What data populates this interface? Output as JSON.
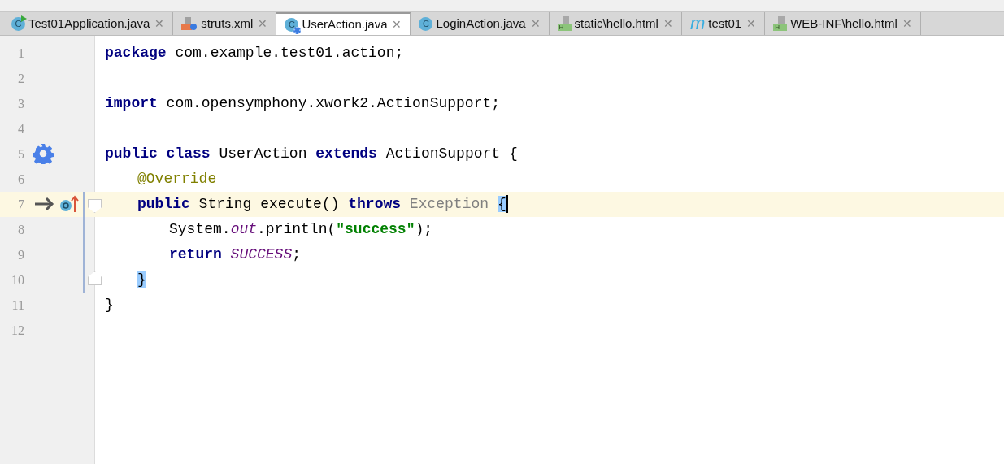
{
  "tabs": [
    {
      "label": "Test01Application.java",
      "selected": false,
      "kind": "spring_class",
      "glyph": "C",
      "close": "✕"
    },
    {
      "label": "struts.xml",
      "selected": false,
      "kind": "xml",
      "close": "✕"
    },
    {
      "label": "UserAction.java",
      "selected": true,
      "kind": "class_gear",
      "glyph": "C",
      "close": "✕"
    },
    {
      "label": "LoginAction.java",
      "selected": false,
      "kind": "class",
      "glyph": "C",
      "close": "✕"
    },
    {
      "label": "static\\hello.html",
      "selected": false,
      "kind": "html",
      "glyph": "H",
      "close": "✕"
    },
    {
      "label": "test01",
      "selected": false,
      "kind": "maven",
      "glyph": "m",
      "close": "✕"
    },
    {
      "label": "WEB-INF\\hello.html",
      "selected": false,
      "kind": "html",
      "glyph": "H",
      "close": "✕"
    }
  ],
  "editor": {
    "lines": [
      {
        "number": "1",
        "tokens": [
          {
            "t": "package",
            "kind": "keyword"
          },
          {
            "t": " com.example.test01.action;",
            "kind": "plain"
          }
        ]
      },
      {
        "number": "2"
      },
      {
        "number": "3",
        "tokens": [
          {
            "t": "import",
            "kind": "keyword"
          },
          {
            "t": " com.opensymphony.xwork2.ActionSupport;",
            "kind": "plain"
          }
        ]
      },
      {
        "number": "4"
      },
      {
        "number": "5",
        "kind": "class_declaration",
        "tokens": [
          {
            "t": "public class",
            "kind": "keyword"
          },
          {
            "t": " UserAction ",
            "kind": "plain"
          },
          {
            "t": "extends",
            "kind": "keyword"
          },
          {
            "t": " ActionSupport {",
            "kind": "plain"
          }
        ],
        "children": [
          {
            "number": "6",
            "tokens": [
              {
                "t": "@Override",
                "kind": "annotation"
              }
            ]
          },
          {
            "number": "7",
            "kind": "overriding_method",
            "current": true,
            "fold_start": true,
            "caret": true,
            "tokens": [
              {
                "t": "public",
                "kind": "keyword"
              },
              {
                "t": " String execute() ",
                "kind": "plain"
              },
              {
                "t": "throws",
                "kind": "keyword"
              },
              {
                "t": " Exception ",
                "kind": "muted"
              },
              {
                "t": "{",
                "kind": "brace_match"
              }
            ],
            "children": [
              {
                "number": "8",
                "tokens": [
                  {
                    "t": "System.",
                    "kind": "plain"
                  },
                  {
                    "t": "out",
                    "kind": "static"
                  },
                  {
                    "t": ".println(",
                    "kind": "plain"
                  },
                  {
                    "t": "\"success\"",
                    "kind": "string"
                  },
                  {
                    "t": ");",
                    "kind": "plain"
                  }
                ]
              },
              {
                "number": "9",
                "tokens": [
                  {
                    "t": "return",
                    "kind": "keyword"
                  },
                  {
                    "t": " SUCCESS",
                    "kind": "static"
                  },
                  {
                    "t": ";",
                    "kind": "plain"
                  }
                ]
              }
            ]
          },
          {
            "number": "10",
            "fold_end": true,
            "tokens": [
              {
                "t": "}",
                "kind": "brace_match"
              }
            ]
          }
        ]
      },
      {
        "number": "11",
        "tokens": [
          {
            "t": "}",
            "kind": "plain"
          }
        ]
      },
      {
        "number": "12"
      }
    ]
  }
}
